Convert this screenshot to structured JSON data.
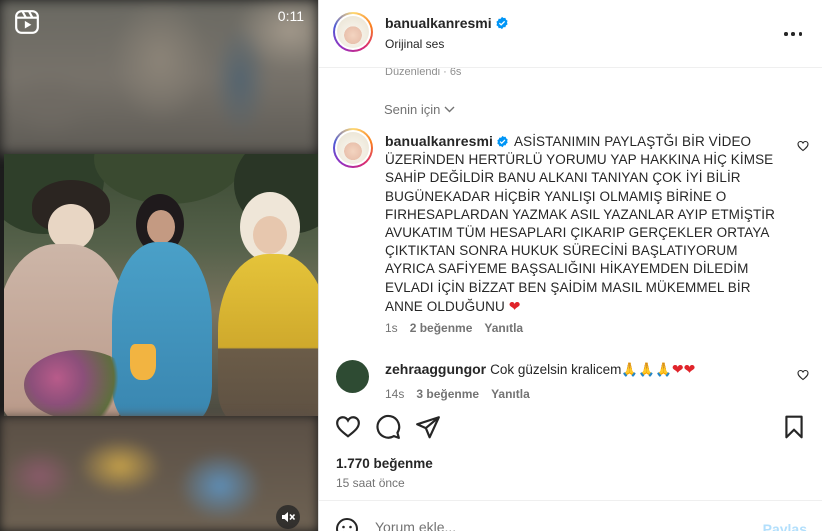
{
  "video": {
    "duration": "0:11",
    "reel_icon": "reels-icon",
    "mute_icon": "muted-speaker-icon"
  },
  "header": {
    "username": "banualkanresmi",
    "audio": "Orijinal ses",
    "more_icon": "more-options-icon"
  },
  "edited_line": "Düzenlendi · 6s",
  "for_you": "Senin için",
  "caption": {
    "username": "banualkanresmi",
    "text": "ASİSTANIMIN PAYLAŞTĞI BİR VİDEO ÜZERİNDEN HERTÜRLÜ YORUMU YAP HAKKINA HİÇ KİMSE SAHİP DEĞİLDİR BANU ALKANI TANIYAN ÇOK İYİ BİLİR BUGÜNEKADAR HİÇBİR YANLIŞI OLMAMIŞ BİRİNE O FIRHESAPLARDAN YAZMAK ASIL YAZANLAR AYIP ETMİŞTİR AVUKATIM TÜM HESAPLARI ÇIKARIP GERÇEKLER ORTAYA ÇIKTIKTAN SONRA HUKUK SÜRECİNİ BAŞLATIYORUM AYRICA SAFİYEME BAŞSALIĞINI HİKAYEMDEN DİLEDİM EVLADI İÇİN BİZZAT BEN ŞAİDİM MASIL MÜKEMMEL BİR ANNE OLDUĞUNU",
    "emoji": "❤",
    "age": "1s",
    "likes": "2 beğenme",
    "reply": "Yanıtla"
  },
  "comment": {
    "username": "zehraaggungor",
    "text": "Cok güzelsin kralicem🙏🙏🙏",
    "hearts": "❤❤",
    "age": "14s",
    "likes": "3 beğenme",
    "reply": "Yanıtla"
  },
  "stats": {
    "likes": "1.770 beğenme",
    "time": "15 saat önce"
  },
  "composer": {
    "placeholder": "Yorum ekle...",
    "post": "Paylaş"
  },
  "colors": {
    "verified": "#0095f6",
    "heart": "#e0242b",
    "post_disabled": "#b2dffc"
  }
}
